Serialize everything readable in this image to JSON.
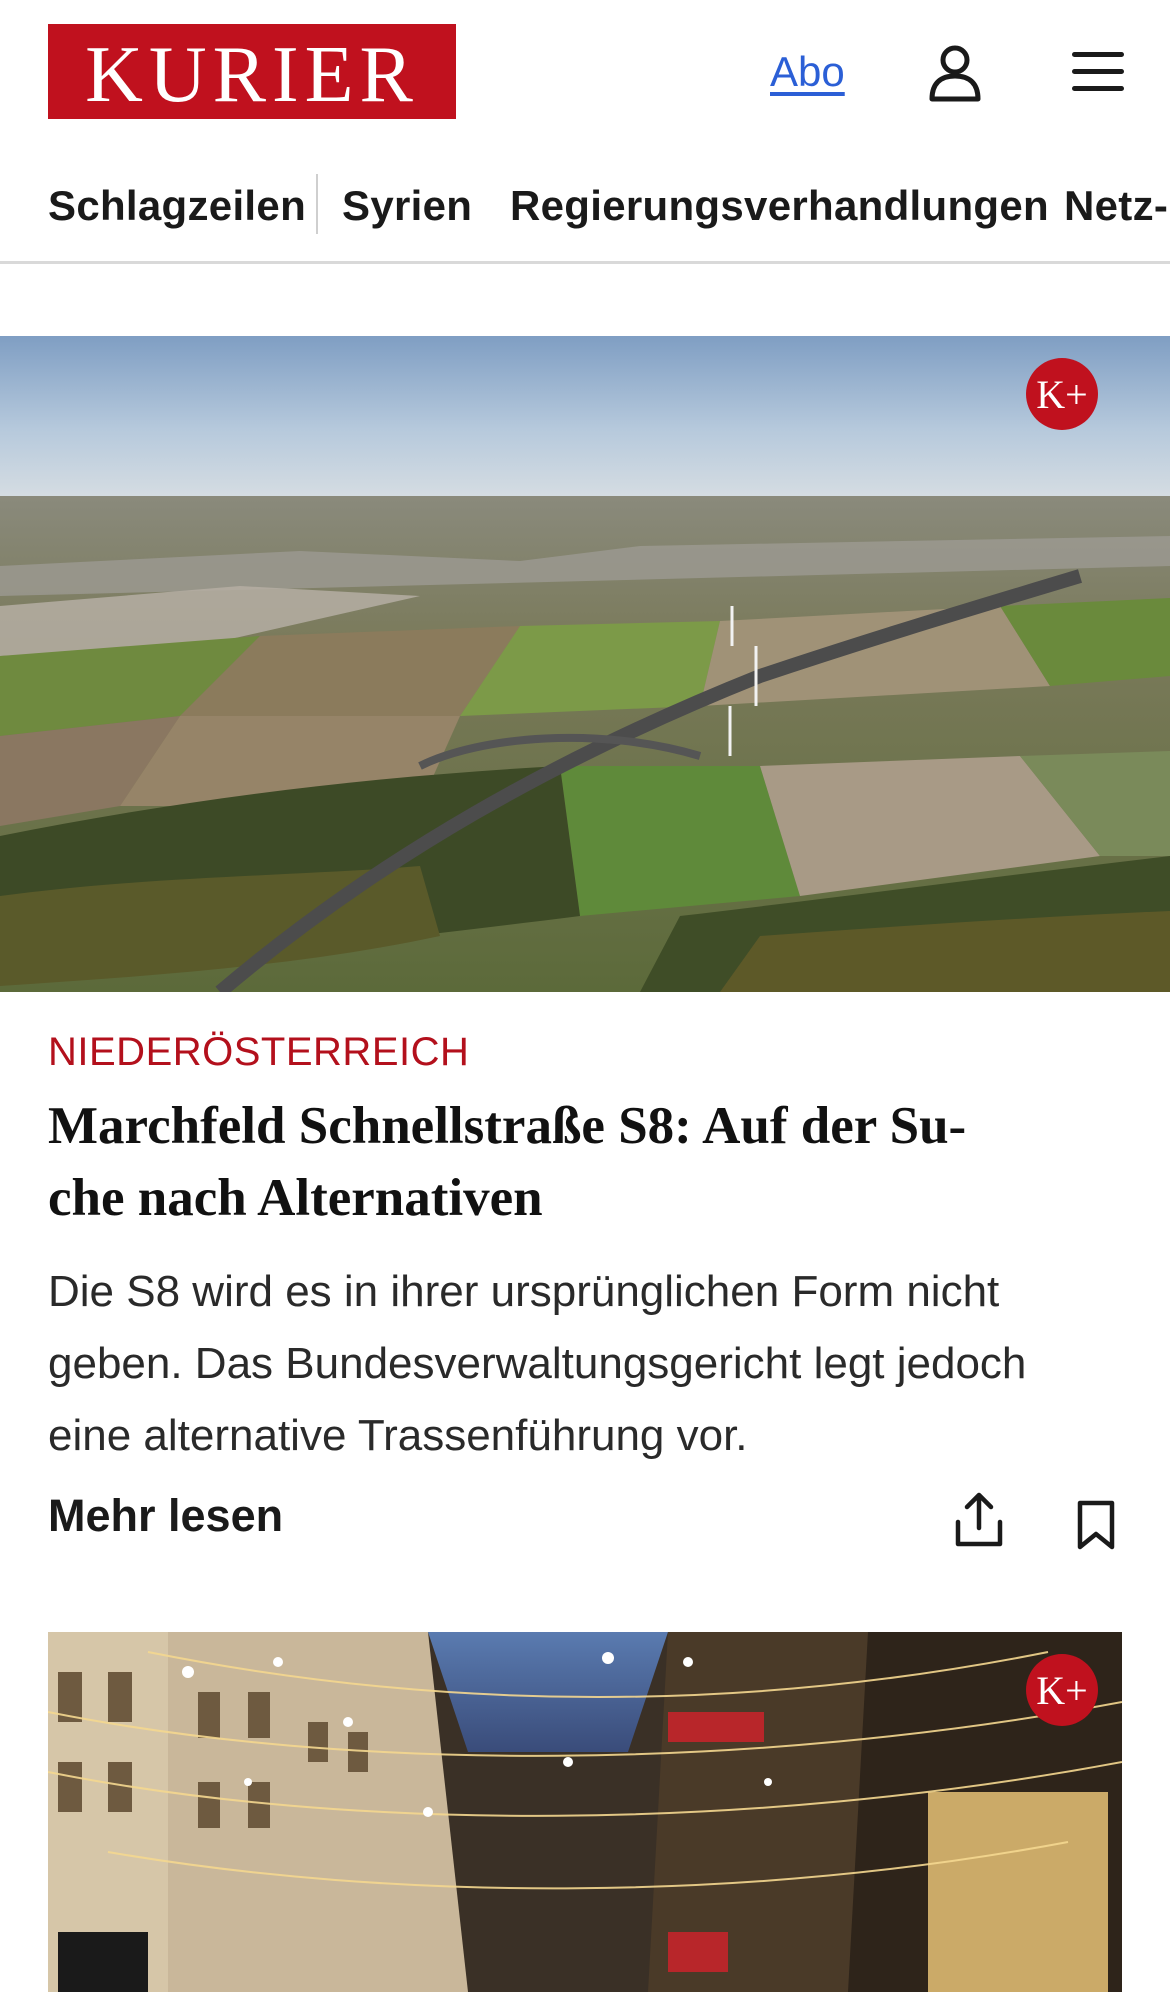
{
  "header": {
    "logo_text": "KURIER",
    "abo_label": "Abo",
    "user_icon": "user-icon",
    "menu_icon": "hamburger-menu-icon"
  },
  "nav": {
    "items": [
      {
        "label": "Schlagzeilen"
      },
      {
        "label": "Syrien"
      },
      {
        "label": "Regierungsverhandlungen"
      },
      {
        "label": "Netz-"
      }
    ]
  },
  "article1": {
    "badge": "K+",
    "category": "NIEDERÖSTERREICH",
    "headline_line1": "Marchfeld Schnellstraße S8: Auf der Su-",
    "headline_line2": "che nach Alternativen",
    "teaser_line1": "Die S8 wird es in ihrer ursprünglichen Form nicht",
    "teaser_line2": "geben. Das Bundesverwaltungsgericht legt jedoch",
    "teaser_line3": "eine alternative Trassenführung vor.",
    "more_label": "Mehr lesen",
    "share_icon": "share-icon",
    "bookmark_icon": "bookmark-icon"
  },
  "article2": {
    "badge": "K+"
  },
  "colors": {
    "brand_red": "#c0111e",
    "category_red": "#b3101c",
    "link_blue": "#2b5fd6"
  }
}
